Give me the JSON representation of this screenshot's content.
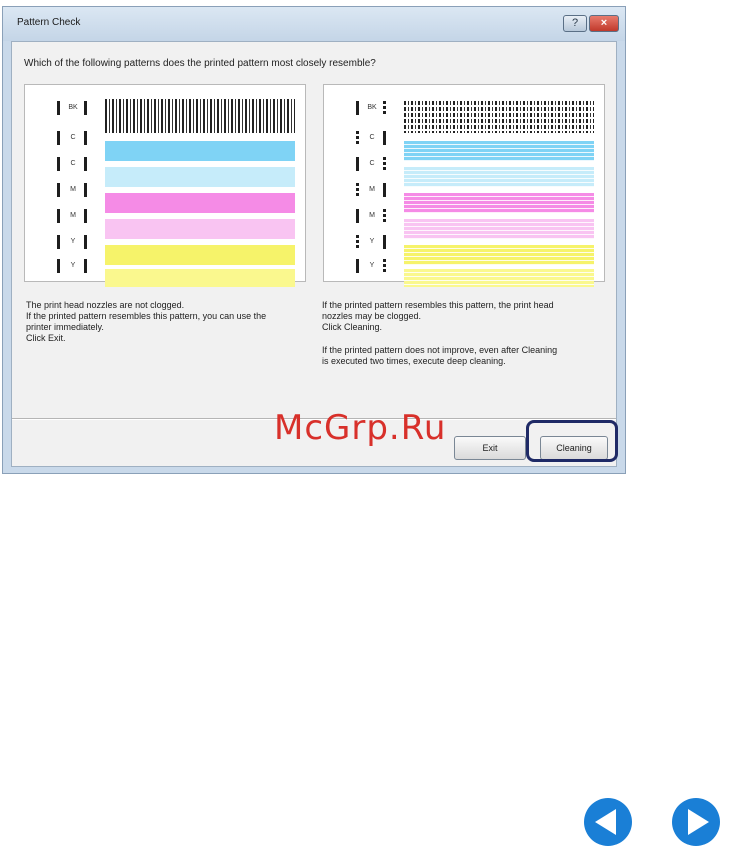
{
  "dialog": {
    "title": "Pattern Check",
    "help_glyph": "?",
    "close_glyph": "×",
    "question": "Which of the following patterns does the printed pattern most closely resemble?"
  },
  "rows": {
    "left": [
      "BK",
      "C",
      "C",
      "M",
      "M",
      "Y",
      "Y"
    ],
    "right": [
      "BK",
      "C",
      "C",
      "M",
      "M",
      "Y",
      "Y"
    ]
  },
  "colors": {
    "cyan": "#7fd3f5",
    "light_cyan": "#c6ecfa",
    "magenta": "#f58be6",
    "light_magenta": "#f9c4f2",
    "yellow": "#f6f36a",
    "light_yellow": "#faf88e",
    "highlight": "#1f2a66",
    "watermark": "#d8302a",
    "nav_arrow": "#1a7fd6"
  },
  "left_panel": {
    "line1": "The print head nozzles are not clogged.",
    "line2": "If the printed pattern resembles this pattern, you can use the",
    "line3": "printer immediately.",
    "line4": "Click Exit."
  },
  "right_panel": {
    "line1": "If the printed pattern resembles this pattern, the print head",
    "line2": "nozzles may be clogged.",
    "line3": "Click Cleaning.",
    "line4": "If the printed pattern does not improve, even after Cleaning",
    "line5": "is executed two times, execute deep cleaning."
  },
  "buttons": {
    "exit": "Exit",
    "cleaning": "Cleaning"
  },
  "watermark": "McGrp.Ru",
  "icons": {
    "prev": "triangle-left-icon",
    "next": "triangle-right-icon"
  }
}
